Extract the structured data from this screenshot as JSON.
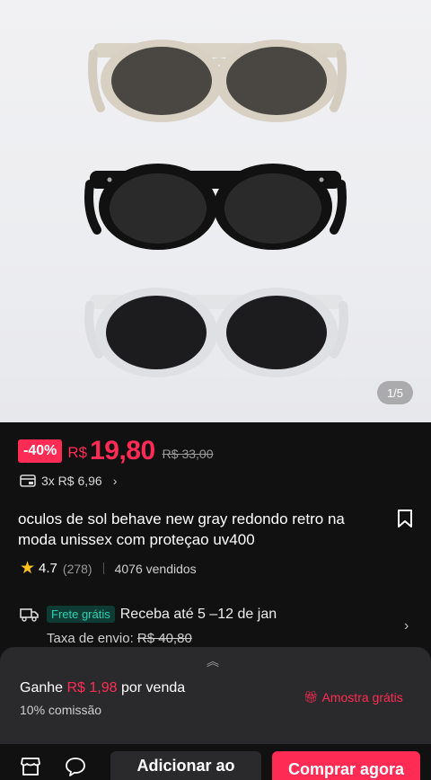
{
  "product": {
    "pager": "1/5",
    "discount": "-40%",
    "currency": "R$",
    "price": "19,80",
    "old_price": "R$ 33,00",
    "installments": "3x R$ 6,96",
    "title": "oculos de sol behave new gray redondo retro na moda unissex com proteçao uv400",
    "rating": "4.7",
    "rating_count": "(278)",
    "sold": "4076 vendidos"
  },
  "shipping": {
    "free_label": "Frete grátis",
    "receive": "Receba até 5 –12 de jan",
    "fee_label": "Taxa de envio: ",
    "fee_old": "R$ 40,80"
  },
  "affiliate": {
    "earn_prefix": "Ganhe ",
    "earn_amount": "R$ 1,98",
    "earn_suffix": " por venda",
    "commission": "10% comissão",
    "sample": "Amostra grátis"
  },
  "bottom_bar": {
    "add_to_cart": "Adicionar ao",
    "buy_now": "Comprar agora"
  },
  "icons": [
    "card-icon",
    "chevron-right-icon",
    "bookmark-icon",
    "star-icon",
    "truck-icon",
    "chevron-up-icon",
    "gift-icon",
    "shop-icon",
    "chat-icon"
  ],
  "colors": {
    "accent": "#fe2c55",
    "free_shipping": "#2fd2b5",
    "star": "#ffc21a"
  }
}
